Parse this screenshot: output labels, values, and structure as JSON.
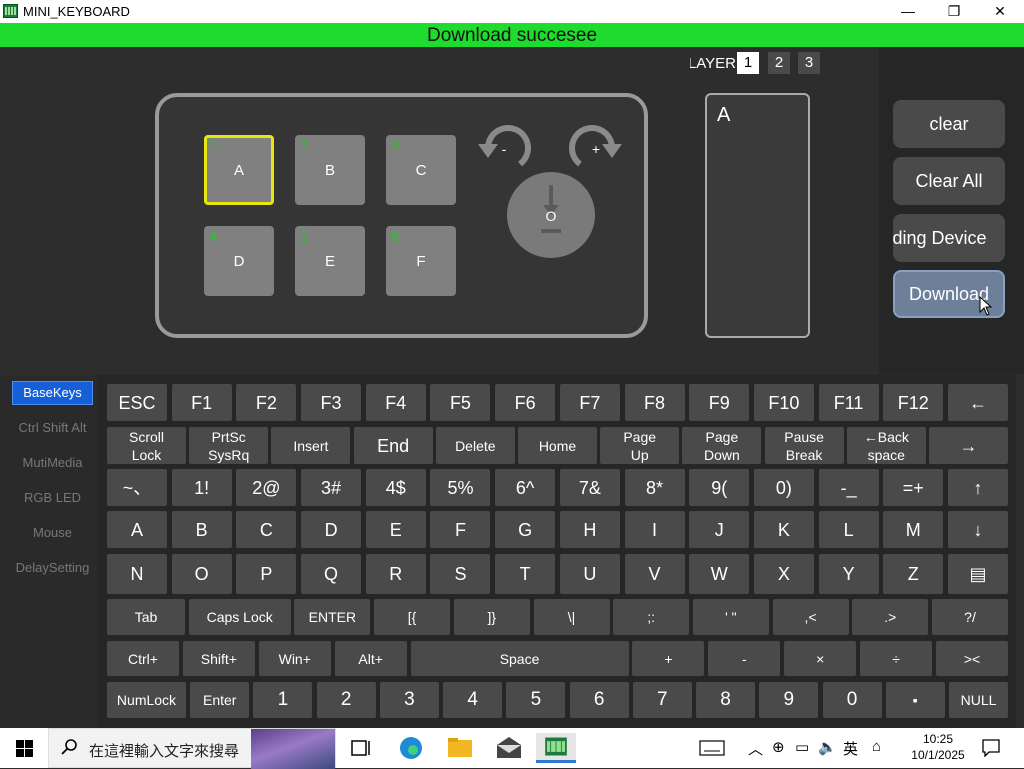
{
  "window": {
    "title": "MINI_KEYBOARD",
    "controls": {
      "minimize": "—",
      "maximize": "❐",
      "close": "✕"
    }
  },
  "status": {
    "text": "Download succesee",
    "color": "#1edc2e"
  },
  "layer": {
    "label": "LAYER",
    "options": [
      "1",
      "2",
      "3"
    ],
    "active": "1"
  },
  "device": {
    "keys": [
      {
        "num": "1",
        "label": "A",
        "selected": true
      },
      {
        "num": "2",
        "label": "B"
      },
      {
        "num": "3",
        "label": "C"
      },
      {
        "num": "4",
        "label": "D"
      },
      {
        "num": "5",
        "label": "E"
      },
      {
        "num": "6",
        "label": "F"
      }
    ],
    "rotate_left_label": "-",
    "rotate_right_label": "+",
    "knob_label": "O"
  },
  "preview": {
    "text": "A"
  },
  "actions": {
    "clear": "clear",
    "clear_all": "Clear All",
    "reading_device": "Reading Device",
    "download": "Download"
  },
  "sidebar": {
    "items": [
      "BaseKeys",
      "Ctrl Shift Alt",
      "MutiMedia",
      "RGB LED",
      "Mouse",
      "DelaySetting"
    ],
    "active": "BaseKeys"
  },
  "keyboard": {
    "rows": [
      [
        "ESC",
        "F1",
        "F2",
        "F3",
        "F4",
        "F5",
        "F6",
        "F7",
        "F8",
        "F9",
        "F10",
        "F11",
        "F12",
        "←"
      ],
      [
        "Scroll\nLock",
        "PrtSc\nSysRq",
        "Insert",
        "End",
        "Delete",
        "Home",
        "Page\nUp",
        "Page\nDown",
        "Pause\nBreak",
        "←Back\nspace",
        "→"
      ],
      [
        "~、",
        "1!",
        "2@",
        "3#",
        "4$",
        "5%",
        "6^",
        "7&",
        "8*",
        "9(",
        "0)",
        "-_",
        "=+",
        "↑"
      ],
      [
        "A",
        "B",
        "C",
        "D",
        "E",
        "F",
        "G",
        "H",
        "I",
        "J",
        "K",
        "L",
        "M",
        "↓"
      ],
      [
        "N",
        "O",
        "P",
        "Q",
        "R",
        "S",
        "T",
        "U",
        "V",
        "W",
        "X",
        "Y",
        "Z",
        "▤"
      ],
      [
        "Tab",
        "Caps Lock",
        "ENTER",
        "[{",
        "]}",
        "\\|",
        ";:",
        "' \"",
        ",<",
        ".>",
        "?/"
      ],
      [
        "Ctrl+",
        "Shift+",
        "Win+",
        "Alt+",
        "Space",
        "+",
        "-",
        "×",
        "÷",
        "><"
      ],
      [
        "NumLock",
        "Enter",
        "1",
        "2",
        "3",
        "4",
        "5",
        "6",
        "7",
        "8",
        "9",
        "0",
        "▪",
        "NULL"
      ]
    ]
  },
  "taskbar": {
    "search_placeholder": "在這裡輸入文字來搜尋",
    "ime": "英",
    "time": "10:25",
    "date": "10/1/2025"
  }
}
